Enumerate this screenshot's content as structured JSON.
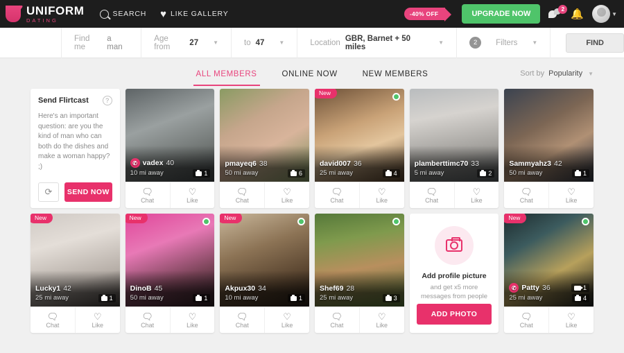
{
  "header": {
    "logo_title": "UNIFORM",
    "logo_sub": "DATING",
    "nav": [
      {
        "label": "SEARCH",
        "icon": "search-icon"
      },
      {
        "label": "LIKE GALLERY",
        "icon": "heart-icon"
      }
    ],
    "promo_label": "-40% OFF",
    "upgrade_label": "UPGRADE NOW",
    "message_count": "2",
    "accent": "#e8447d",
    "upgrade_color": "#4fc46a"
  },
  "search": {
    "find_me_label": "Find me",
    "find_me_value": "a man",
    "age_from_label": "Age from",
    "age_from_value": "27",
    "age_to_label": "to",
    "age_to_value": "47",
    "location_label": "Location",
    "location_value": "GBR, Barnet + 50 miles",
    "filters_label": "Filters",
    "filters_count": "2",
    "find_button": "FIND"
  },
  "tabs": [
    {
      "label": "ALL MEMBERS",
      "active": true
    },
    {
      "label": "ONLINE NOW",
      "active": false
    },
    {
      "label": "NEW MEMBERS",
      "active": false
    }
  ],
  "sort": {
    "label": "Sort by",
    "value": "Popularity"
  },
  "flirtcast": {
    "title": "Send Flirtcast",
    "help_icon": "question-mark-icon",
    "message": "Here's an important question: are you the kind of man who can both do the dishes and make a woman happy? ;)",
    "refresh_icon": "refresh-icon",
    "send_label": "SEND NOW"
  },
  "add_photo": {
    "icon": "camera-icon",
    "title": "Add profile picture",
    "subtitle": "and get x5 more messages from people",
    "button_label": "ADD PHOTO"
  },
  "card_actions": {
    "chat": "Chat",
    "like": "Like",
    "new_badge": "New"
  },
  "members": [
    {
      "name": "vadex",
      "age": "40",
      "distance": "10 mi away",
      "photos": "1",
      "videos": null,
      "new": false,
      "online": false,
      "flirt": true,
      "bg": "linear-gradient(160deg,#5e6466 0%,#9aa0a0 38%,#6d7270 72%,#3c4143 100%)"
    },
    {
      "name": "pmayeq6",
      "age": "38",
      "distance": "50 mi away",
      "photos": "6",
      "videos": null,
      "new": false,
      "online": false,
      "flirt": false,
      "bg": "linear-gradient(150deg,#8a9b63 0%,#c6a68c 35%,#d8b49b 60%,#7b8f5c 100%)"
    },
    {
      "name": "david007",
      "age": "36",
      "distance": "25 mi away",
      "photos": "4",
      "videos": null,
      "new": true,
      "online": true,
      "flirt": false,
      "bg": "linear-gradient(160deg,#6d5138 0%,#c9a277 40%,#e3c59d 62%,#4c3824 100%)"
    },
    {
      "name": "plamberttimc70",
      "age": "33",
      "distance": "5 mi away",
      "photos": "2",
      "videos": null,
      "new": false,
      "online": false,
      "flirt": false,
      "bg": "linear-gradient(170deg,#b9bcbe 0%,#d6d3cf 30%,#9c9a96 70%,#53585a 100%)"
    },
    {
      "name": "Sammyahz3",
      "age": "42",
      "distance": "50 mi away",
      "photos": "1",
      "videos": null,
      "new": false,
      "online": false,
      "flirt": false,
      "bg": "linear-gradient(150deg,#3b4350 0%,#7c6654 40%,#b09074 65%,#2c3340 100%)"
    },
    {
      "name": "Lucky1",
      "age": "42",
      "distance": "25 mi away",
      "photos": "1",
      "videos": null,
      "new": true,
      "online": false,
      "flirt": false,
      "bg": "linear-gradient(165deg,#cfc9c4 0%,#e4ded8 32%,#b6aea7 68%,#3a3532 100%)"
    },
    {
      "name": "DinoB",
      "age": "45",
      "distance": "50 mi away",
      "photos": "1",
      "videos": null,
      "new": true,
      "online": true,
      "flirt": false,
      "bg": "linear-gradient(160deg,#e0469a 0%,#e879b6 34%,#7a4458 68%,#241a1c 100%)"
    },
    {
      "name": "Akpux30",
      "age": "34",
      "distance": "10 mi away",
      "photos": "1",
      "videos": null,
      "new": true,
      "online": true,
      "flirt": false,
      "bg": "linear-gradient(160deg,#c9b79b 0%,#8c7355 38%,#5a4530 70%,#231a12 100%)"
    },
    {
      "name": "Shef69",
      "age": "28",
      "distance": "25 mi away",
      "photos": "3",
      "videos": null,
      "new": false,
      "online": true,
      "flirt": false,
      "bg": "linear-gradient(170deg,#56793a 0%,#7f9a4d 28%,#b88f5e 58%,#4d6b33 100%)"
    },
    {
      "name": "Patty",
      "age": "36",
      "distance": "25 mi away",
      "photos": "4",
      "videos": "1",
      "new": true,
      "online": true,
      "flirt": true,
      "bg": "linear-gradient(150deg,#1d2b2e 0%,#3c5b5e 30%,#b7a05c 62%,#15191b 100%)"
    }
  ]
}
